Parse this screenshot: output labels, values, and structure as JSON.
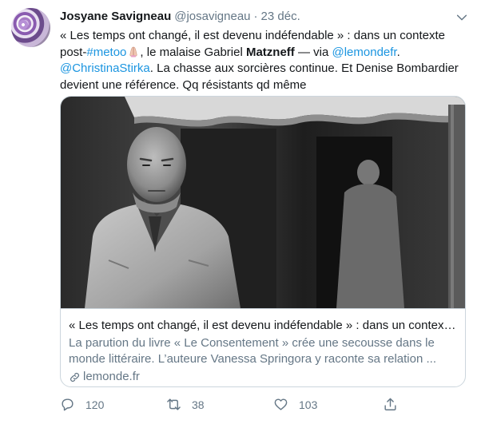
{
  "tweet": {
    "author_name": "Josyane Savigneau",
    "author_handle": "@josavigneau",
    "separator": "·",
    "date": "23 déc.",
    "text": {
      "p1": "« Les temps ont changé, il est devenu indéfendable » : dans un contexte post-",
      "hashtag": "#metoo",
      "p2": ", le malaise Gabriel ",
      "bold": "Matzneff",
      "p3": " — via ",
      "mention1": "@lemondefr",
      "p4": ". ",
      "mention2": "@ChristinaStirka",
      "p5": ". La chasse aux sorcières continue. Et Denise Bombardier devient une référence. Qq résistants qd même"
    }
  },
  "card": {
    "title": "« Les temps ont changé, il est devenu indéfendable » : dans un contexte...",
    "description": "La parution du livre « Le Consentement » crée une secousse dans le monde littéraire. L’auteure Vanessa Springora y raconte sa relation ...",
    "domain": "lemonde.fr"
  },
  "actions": {
    "replies": "120",
    "retweets": "38",
    "likes": "103"
  },
  "icons": {
    "caret": "chevron-down-icon",
    "reply": "reply-icon",
    "retweet": "retweet-icon",
    "like": "heart-icon",
    "share": "share-icon",
    "link": "link-icon",
    "emoji": "praying-hands-icon"
  },
  "colors": {
    "link": "#1b95e0",
    "secondary_text": "#657786",
    "border": "#ccd6dd"
  }
}
